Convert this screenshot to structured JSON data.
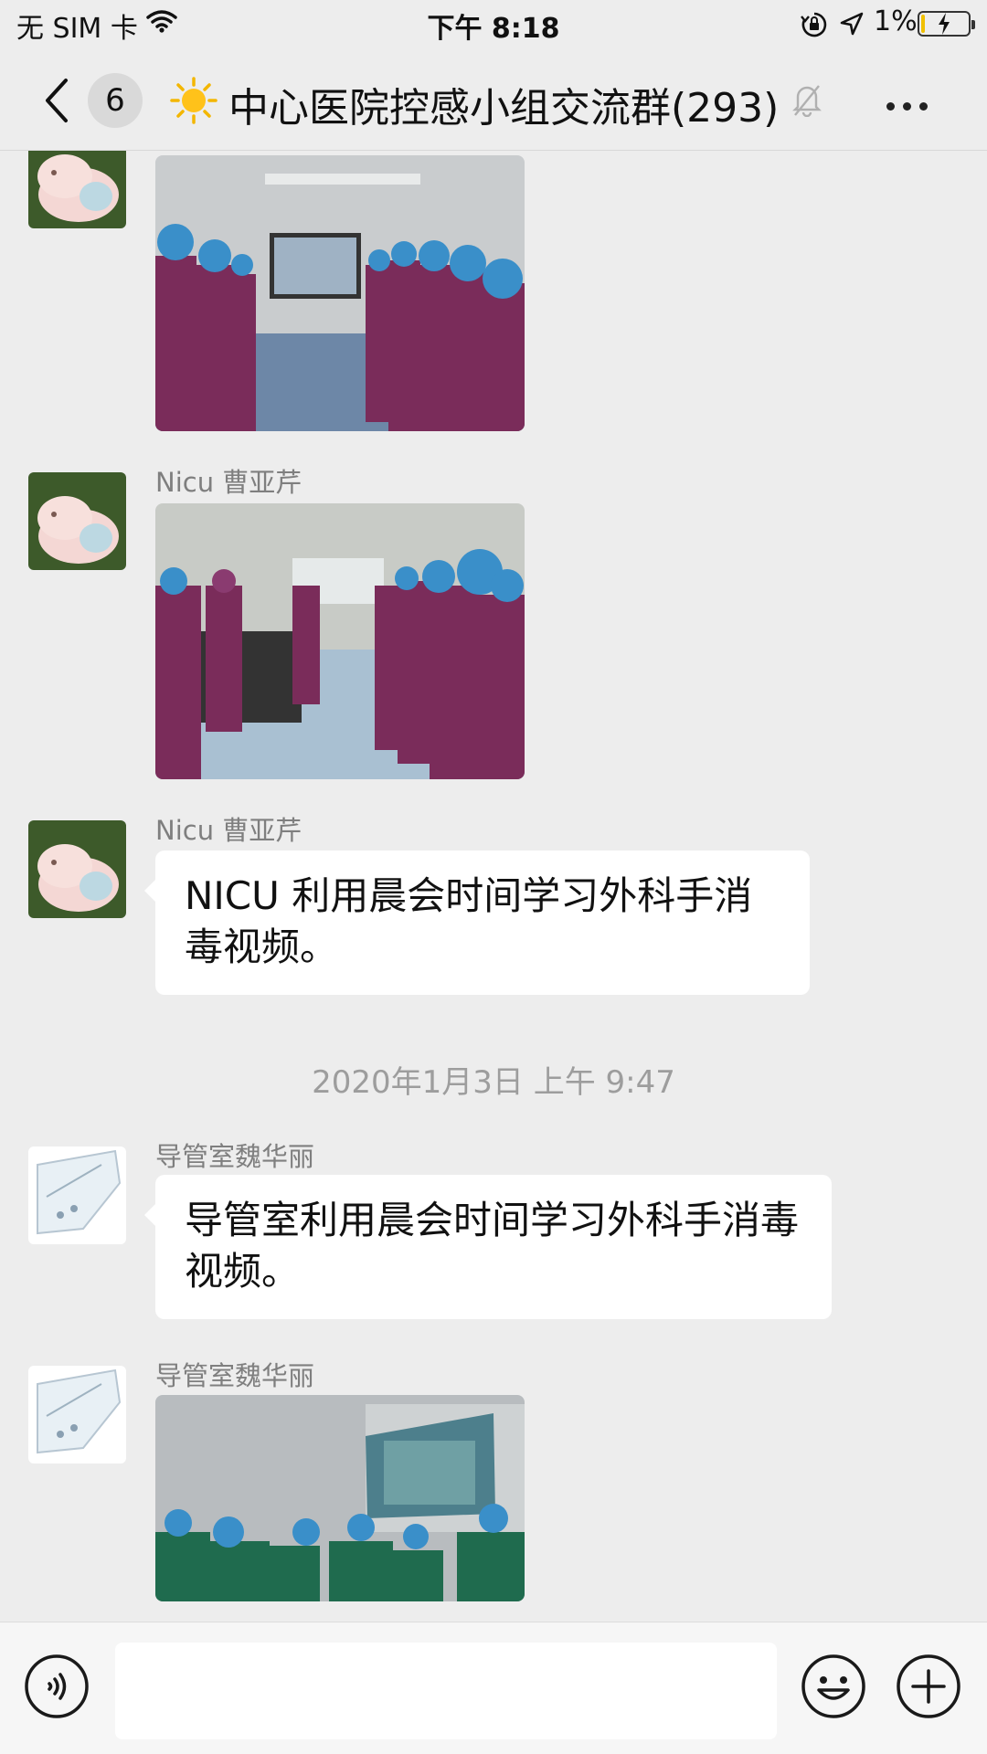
{
  "status_bar": {
    "carrier": "无 SIM 卡",
    "time": "下午 8:18",
    "battery_percent_text": "1%",
    "battery_level": 0.01,
    "wifi_icon": "wifi-icon",
    "location_icon": "location-arrow-icon",
    "rotation_lock_icon": "rotation-lock-icon",
    "charging": true
  },
  "header": {
    "back_icon": "chevron-left-icon",
    "unread_count": "6",
    "group_icon": "sun-emoji",
    "title": "中心医院控感小组交流群(293)",
    "muted_icon": "bell-slash-icon",
    "more_icon": "more-dots-icon"
  },
  "messages": [
    {
      "type": "image",
      "sender": "",
      "avatar": "pig-avatar",
      "image_desc": "photo"
    },
    {
      "type": "image",
      "sender": "Nicu 曹亚芹",
      "avatar": "pig-avatar",
      "image_desc": "photo"
    },
    {
      "type": "text",
      "sender": "Nicu 曹亚芹",
      "avatar": "pig-avatar",
      "text": "NICU 利用晨会时间学习外科手消毒视频。"
    },
    {
      "type": "timestamp",
      "text": "2020年1月3日 上午 9:47"
    },
    {
      "type": "text",
      "sender": "导管室魏华丽",
      "avatar": "sketch-avatar",
      "text": "导管室利用晨会时间学习外科手消毒视频。"
    },
    {
      "type": "image",
      "sender": "导管室魏华丽",
      "avatar": "sketch-avatar",
      "image_desc": "photo"
    }
  ],
  "input_bar": {
    "voice_icon": "voice-icon",
    "input_value": "",
    "emoji_icon": "emoji-icon",
    "plus_icon": "plus-circle-icon"
  },
  "colors": {
    "background": "#ededed",
    "bubble": "#ffffff",
    "sender_text": "#7f7f7f",
    "timestamp_text": "#9d9d9d",
    "battery_fill": "#f0c000",
    "scrub_purple": "#7a2c5a",
    "cap_blue": "#3a8fc9",
    "scrub_green": "#1f6b4e"
  }
}
